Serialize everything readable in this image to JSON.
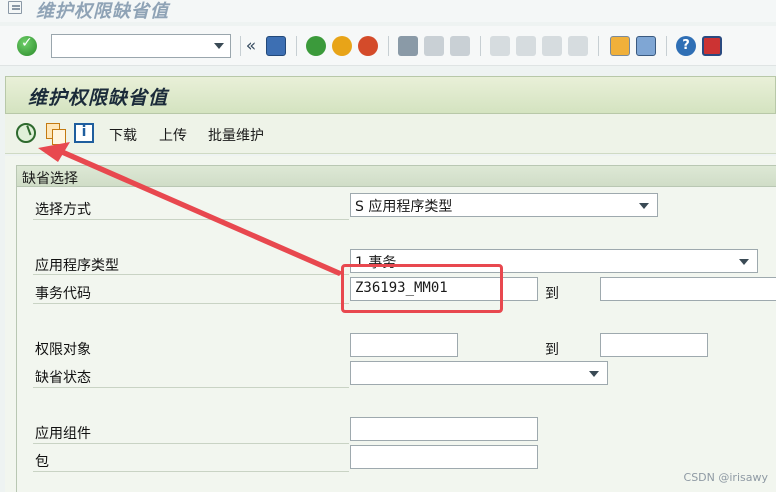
{
  "window": {
    "title": "维护权限缺省值"
  },
  "toolbar": {
    "command_value": ""
  },
  "page_title": "维护权限缺省值",
  "app_toolbar": {
    "download": "下载",
    "upload": "上传",
    "bulk_maintain": "批量维护"
  },
  "group": {
    "title": "缺省选择",
    "select_method_label": "选择方式",
    "select_method_value": "S 应用程序类型",
    "app_type_label": "应用程序类型",
    "app_type_value": "1 事务",
    "tcode_label": "事务代码",
    "tcode_from": "Z36193_MM01",
    "tcode_to": "",
    "to_label": "到",
    "authobj_label": "权限对象",
    "authobj_from": "",
    "authobj_to": "",
    "default_status_label": "缺省状态",
    "default_status_value": "",
    "app_component_label": "应用组件",
    "app_component_value": "",
    "package_label": "包",
    "package_value": ""
  },
  "watermark": "CSDN @irisawy",
  "colors": {
    "highlight": "#e8484f"
  }
}
